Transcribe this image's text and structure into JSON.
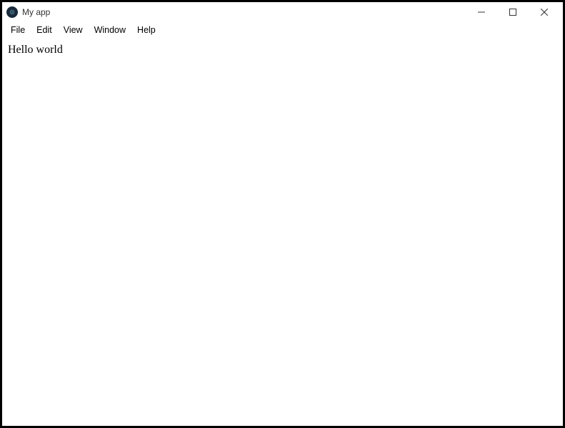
{
  "window": {
    "title": "My app"
  },
  "menu": {
    "items": [
      "File",
      "Edit",
      "View",
      "Window",
      "Help"
    ]
  },
  "content": {
    "text": "Hello world"
  }
}
